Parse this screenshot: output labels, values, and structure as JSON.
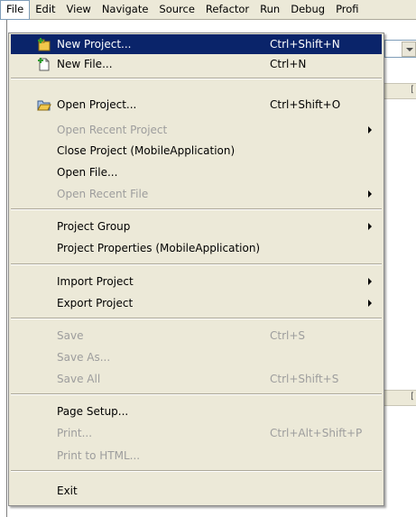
{
  "menubar": {
    "items": [
      {
        "label": "File"
      },
      {
        "label": "Edit"
      },
      {
        "label": "View"
      },
      {
        "label": "Navigate"
      },
      {
        "label": "Source"
      },
      {
        "label": "Refactor"
      },
      {
        "label": "Run"
      },
      {
        "label": "Debug"
      },
      {
        "label": "Profi"
      }
    ]
  },
  "menu": {
    "items": [
      {
        "label": "New Project...",
        "shortcut": "Ctrl+Shift+N",
        "icon": "new-project-icon",
        "highlighted": true
      },
      {
        "label": "New File...",
        "shortcut": "Ctrl+N",
        "icon": "new-file-icon"
      },
      {
        "label": "Open Project...",
        "shortcut": "Ctrl+Shift+O",
        "icon": "open-project-icon"
      },
      {
        "label": "Open Recent Project",
        "disabled": true,
        "submenu": true
      },
      {
        "label": "Close Project (MobileApplication)"
      },
      {
        "label": "Open File..."
      },
      {
        "label": "Open Recent File",
        "disabled": true,
        "submenu": true
      },
      {
        "label": "Project Group",
        "submenu": true
      },
      {
        "label": "Project Properties (MobileApplication)"
      },
      {
        "label": "Import Project",
        "submenu": true
      },
      {
        "label": "Export Project",
        "submenu": true
      },
      {
        "label": "Save",
        "shortcut": "Ctrl+S",
        "disabled": true
      },
      {
        "label": "Save As...",
        "disabled": true
      },
      {
        "label": "Save All",
        "shortcut": "Ctrl+Shift+S",
        "disabled": true
      },
      {
        "label": "Page Setup..."
      },
      {
        "label": "Print...",
        "shortcut": "Ctrl+Alt+Shift+P",
        "disabled": true
      },
      {
        "label": "Print to HTML...",
        "disabled": true
      },
      {
        "label": "Exit"
      }
    ]
  },
  "colors": {
    "menu_background": "#ece9d8",
    "highlight": "#0a246a",
    "disabled_text": "#9d9d9d"
  }
}
